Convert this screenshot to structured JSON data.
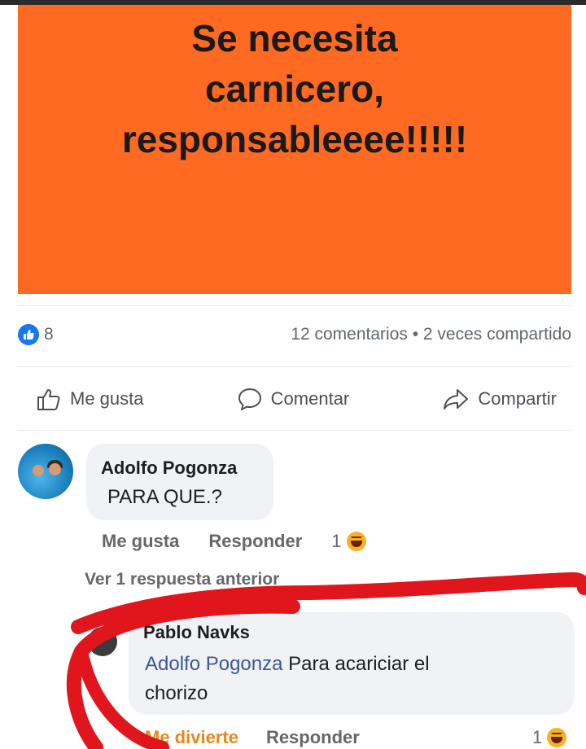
{
  "post": {
    "image_text_lines": [
      "Se necesita",
      "carnicero,",
      "responsableeee!!!!!"
    ],
    "image_bg_color": "#ff6a22"
  },
  "stats": {
    "like_count": "8",
    "comments_shares": "12 comentarios • 2 veces compartido"
  },
  "actions": {
    "like": "Me gusta",
    "comment": "Comentar",
    "share": "Compartir"
  },
  "comments": [
    {
      "author": "Adolfo Pogonza",
      "text": "PARA QUE.?",
      "like_label": "Me gusta",
      "reply_label": "Responder",
      "reaction_count": "1",
      "reaction_icon": "haha-emoji-icon"
    }
  ],
  "view_previous_replies": "Ver 1 respuesta anterior",
  "reply": {
    "author": "Pablo Navks",
    "mention": "Adolfo Pogonza",
    "text_line1": "Para acariciar el",
    "text_line2": "chorizo",
    "reaction_label": "Me divierte",
    "reply_label": "Responder",
    "reaction_count": "1",
    "reaction_icon": "haha-emoji-icon"
  },
  "colors": {
    "like_blue": "#1877f2",
    "mention_blue": "#385898",
    "haha_orange": "#e8891b",
    "annotation_red": "#e0161c"
  }
}
